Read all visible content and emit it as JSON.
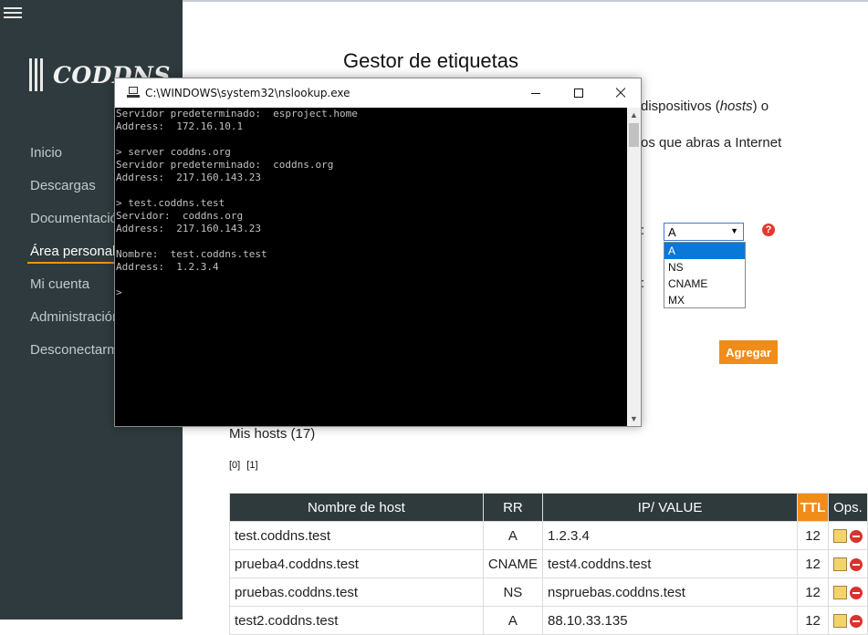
{
  "sidebar": {
    "brand": "CODDNS",
    "items": [
      {
        "label": "Inicio",
        "active": false
      },
      {
        "label": "Descargas",
        "active": false
      },
      {
        "label": "Documentación",
        "active": false
      },
      {
        "label": "Área personal",
        "active": true
      },
      {
        "label": "Mi cuenta",
        "active": false
      },
      {
        "label": "Administración",
        "active": false
      },
      {
        "label": "Desconectarme",
        "active": false
      }
    ]
  },
  "main": {
    "title": "Gestor de etiquetas",
    "para_line1_a": "dispositivos (",
    "para_line1_em": "hosts",
    "para_line1_b": ") o",
    "para_line2": "os que abras a Internet",
    "colon_label": ":",
    "record_type_select": {
      "value": "A",
      "options": [
        "A",
        "NS",
        "CNAME",
        "MX"
      ],
      "selected_index": 0
    },
    "help_icon_text": "?",
    "add_button": "Agregar",
    "hosts_title": "Mis hosts (17)",
    "pages": [
      "[0]",
      "[1]"
    ],
    "table": {
      "headers": [
        "Nombre de host",
        "RR",
        "IP/ VALUE",
        "TTL",
        "Ops."
      ],
      "rows": [
        {
          "host": "test.coddns.test",
          "rr": "A",
          "value": "1.2.3.4",
          "ttl": "12"
        },
        {
          "host": "prueba4.coddns.test",
          "rr": "CNAME",
          "value": "test4.coddns.test",
          "ttl": "12"
        },
        {
          "host": "pruebas.coddns.test",
          "rr": "NS",
          "value": "nspruebas.coddns.test",
          "ttl": "12"
        },
        {
          "host": "test2.coddns.test",
          "rr": "A",
          "value": "88.10.33.135",
          "ttl": "12"
        }
      ]
    }
  },
  "console_window": {
    "title": "C:\\WINDOWS\\system32\\nslookup.exe",
    "lines": [
      "Servidor predeterminado:  esproject.home",
      "Address:  172.16.10.1",
      "",
      "> server coddns.org",
      "Servidor predeterminado:  coddns.org",
      "Address:  217.160.143.23",
      "",
      "> test.coddns.test",
      "Servidor:  coddns.org",
      "Address:  217.160.143.23",
      "",
      "Nombre:  test.coddns.test",
      "Address:  1.2.3.4",
      "",
      ">"
    ]
  }
}
